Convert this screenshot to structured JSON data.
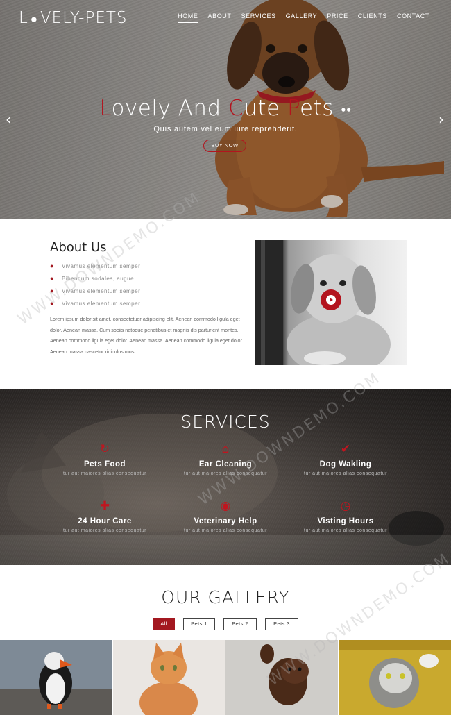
{
  "brand": {
    "name_prefix": "L",
    "name_suffix": "VELY-PETS",
    "paw_glyph": "❀"
  },
  "nav": {
    "items": [
      "HOME",
      "ABOUT",
      "SERVICES",
      "GALLERY",
      "PRICE",
      "CLIENTS",
      "CONTACT"
    ],
    "active_index": 0
  },
  "hero": {
    "title_parts": [
      {
        "text": "L",
        "accent": true
      },
      {
        "text": "ovely And ",
        "accent": false
      },
      {
        "text": "C",
        "accent": true
      },
      {
        "text": "ute ",
        "accent": false
      },
      {
        "text": "P",
        "accent": true
      },
      {
        "text": "ets",
        "accent": false
      }
    ],
    "subtitle": "Quis autem vel eum iure reprehderit.",
    "cta_label": "BUY NOW",
    "prev_arrow": "‹",
    "next_arrow": "›"
  },
  "about": {
    "title": "About Us",
    "list": [
      "Vivamus elementum semper",
      "Bibendum sodales, augue",
      "Vivamus elementum semper",
      "Vivamus elementum semper"
    ],
    "paragraph": "Lorem ipsum dolor sit amet, consectetuer adipiscing elit. Aenean commodo ligula eget dolor. Aenean massa. Cum sociis natoque penatibus et magnis dis parturient montes. Aenean commodo ligula eget dolor. Aenean massa. Aenean commodo ligula eget dolor. Aenean massa nascetur ridiculus mus."
  },
  "services": {
    "title": "SERVICES",
    "items": [
      {
        "title": "Pets Food",
        "desc": "tur aut maiores alias consequatur",
        "icon": "recycle-icon",
        "glyph": "↻"
      },
      {
        "title": "Ear Cleaning",
        "desc": "tur aut maiores alias consequatur",
        "icon": "home-icon",
        "glyph": "⌂"
      },
      {
        "title": "Dog Wakling",
        "desc": "tur aut maiores alias consequatur",
        "icon": "check-icon",
        "glyph": "✔"
      },
      {
        "title": "24 Hour Care",
        "desc": "tur aut maiores alias consequatur",
        "icon": "medkit-icon",
        "glyph": "✚"
      },
      {
        "title": "Veterinary Help",
        "desc": "tur aut maiores alias consequatur",
        "icon": "eye-icon",
        "glyph": "◉"
      },
      {
        "title": "Visting Hours",
        "desc": "tur aut maiores alias consequatur",
        "icon": "clock-icon",
        "glyph": "◷"
      }
    ]
  },
  "gallery": {
    "title": "OUR GALLERY",
    "filters": [
      "All",
      "Pets 1",
      "Pets 2",
      "Pets 3"
    ],
    "active_filter": 0,
    "images": [
      "puffin-photo",
      "ginger-cat-photo",
      "puppy-photo",
      "tabby-cat-photo"
    ]
  },
  "watermark": "WWW.DOWNDEMO.COM",
  "colors": {
    "accent": "#b3141e"
  }
}
